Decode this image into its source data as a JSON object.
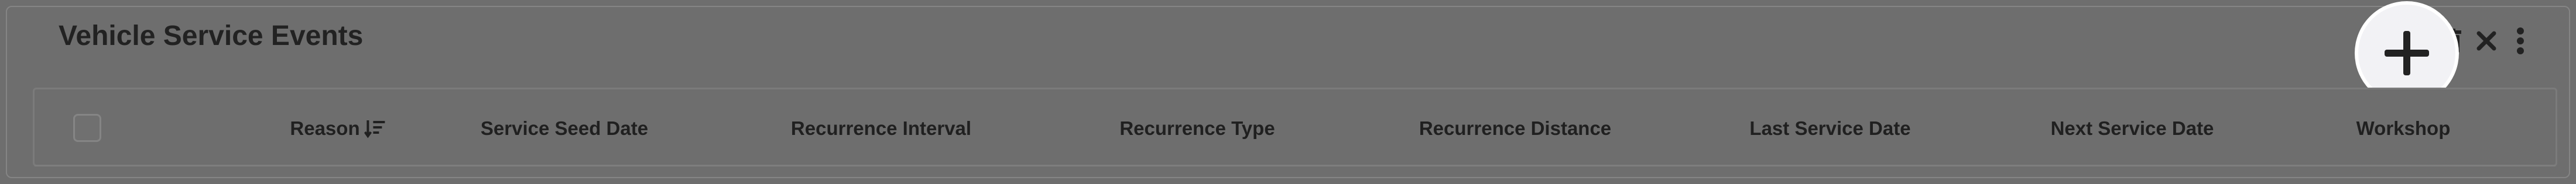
{
  "panel": {
    "title": "Vehicle Service Events"
  },
  "toolbar": {
    "buttons": [
      {
        "name": "add",
        "icon": "plus-icon"
      },
      {
        "name": "delete",
        "icon": "trash-icon"
      },
      {
        "name": "close",
        "icon": "close-icon"
      },
      {
        "name": "more",
        "icon": "more-vertical-icon"
      }
    ]
  },
  "table": {
    "columns": [
      {
        "label": "Reason",
        "sortable": true,
        "sort_icon": "sort-descending-icon"
      },
      {
        "label": "Service Seed Date"
      },
      {
        "label": "Recurrence Interval"
      },
      {
        "label": "Recurrence Type"
      },
      {
        "label": "Recurrence Distance"
      },
      {
        "label": "Last Service Date"
      },
      {
        "label": "Next Service Date"
      },
      {
        "label": "Workshop"
      }
    ]
  },
  "colors": {
    "overlay_background": "#6e6e6e",
    "text_dark": "#222222",
    "highlight": "#f2f2f5"
  }
}
